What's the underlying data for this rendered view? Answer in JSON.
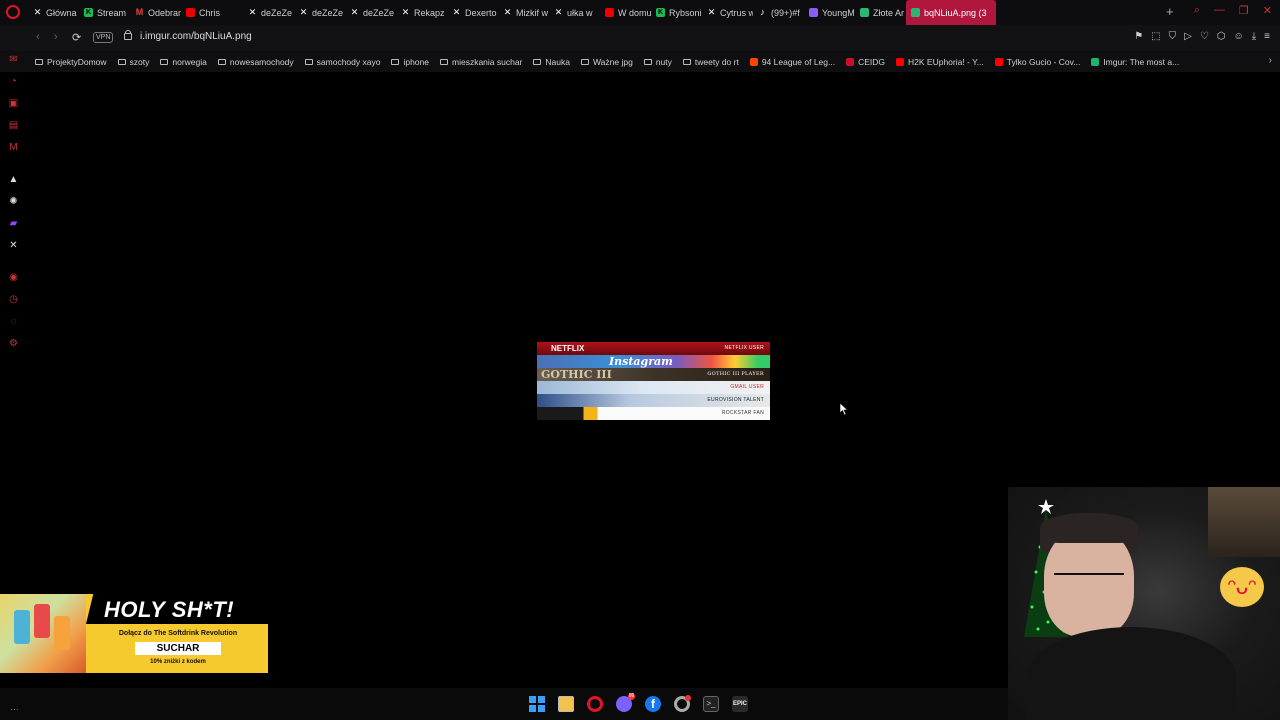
{
  "browser": {
    "tabs": [
      {
        "label": "Główna",
        "icon": "x-logo"
      },
      {
        "label": "Stream",
        "icon": "kick-logo"
      },
      {
        "label": "Odebran",
        "icon": "gmail-logo"
      },
      {
        "label": "Chris",
        "icon": "youtube-logo"
      },
      {
        "label": "deZeZe",
        "icon": "x-logo"
      },
      {
        "label": "deZeZe",
        "icon": "x-logo"
      },
      {
        "label": "deZeZe",
        "icon": "x-logo"
      },
      {
        "label": "Rekapz",
        "icon": "x-logo"
      },
      {
        "label": "Dexerto",
        "icon": "x-logo"
      },
      {
        "label": "Mizkif w",
        "icon": "x-logo"
      },
      {
        "label": "ułka w",
        "icon": "x-logo"
      },
      {
        "label": "W domu",
        "icon": "youtube-logo"
      },
      {
        "label": "Rybsoni",
        "icon": "kick-logo"
      },
      {
        "label": "Cytrus w",
        "icon": "x-logo"
      },
      {
        "label": "(99+)#f",
        "icon": "tiktok-logo"
      },
      {
        "label": "YoungM",
        "icon": "twitch-logo"
      },
      {
        "label": "Złote Ar",
        "icon": "sheets-logo"
      },
      {
        "label": "bqNLiuA.png (3",
        "icon": "imgur-logo",
        "active": true
      }
    ],
    "vpn_label": "VPN",
    "url": "i.imgur.com/bqNLiuA.png",
    "bookmarks": [
      {
        "label": "ProjektyDomow",
        "type": "folder"
      },
      {
        "label": "szoty",
        "type": "folder"
      },
      {
        "label": "norwegia",
        "type": "folder"
      },
      {
        "label": "nowesamochody",
        "type": "folder"
      },
      {
        "label": "samochody xayo",
        "type": "folder"
      },
      {
        "label": "iphone",
        "type": "folder"
      },
      {
        "label": "mieszkania suchar",
        "type": "folder"
      },
      {
        "label": "Nauka",
        "type": "folder"
      },
      {
        "label": "Ważne jpg",
        "type": "folder"
      },
      {
        "label": "nuty",
        "type": "folder"
      },
      {
        "label": "tweety do rt",
        "type": "folder"
      },
      {
        "label": "94 League of Leg...",
        "type": "site",
        "color": "#ff4500"
      },
      {
        "label": "CEIDG",
        "type": "site",
        "color": "#c8102e"
      },
      {
        "label": "H2K EUphoria! - Y...",
        "type": "site",
        "color": "#ff0000"
      },
      {
        "label": "Tylko Gucio - Cov...",
        "type": "site",
        "color": "#ff0000"
      },
      {
        "label": "Imgur: The most a...",
        "type": "site",
        "color": "#1bb76e"
      }
    ]
  },
  "image": {
    "strips": [
      {
        "left": "NETFLIX",
        "right": "NETFLIX USER"
      },
      {
        "left": "Instagram",
        "right": ""
      },
      {
        "left": "GOTHIC III",
        "right": "GOTHIC III PLAYER"
      },
      {
        "left": "",
        "right": "GMAIL USER"
      },
      {
        "left": "",
        "right": "EUROVISION TALENT"
      },
      {
        "left": "",
        "right": "ROCKSTAR FAN"
      }
    ]
  },
  "ad": {
    "title": "HOLY SH*T!",
    "subtitle": "Dołącz do The Softdrink Revolution",
    "code": "SUCHAR",
    "discount": "10% zniżki z kodem"
  },
  "colors": {
    "accent": "#b1163d",
    "opera_red": "#e0132b"
  }
}
